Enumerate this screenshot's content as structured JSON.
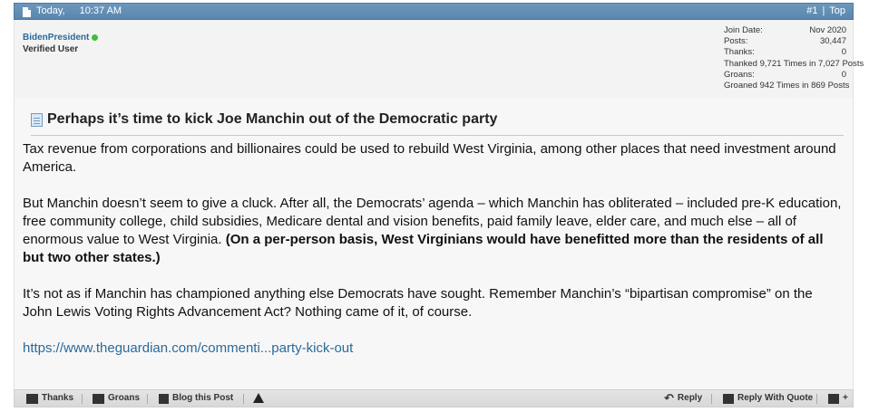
{
  "header": {
    "date": "Today,",
    "time": "10:37 AM",
    "post_number": "#1",
    "separator": "|",
    "top_link": "Top"
  },
  "user": {
    "name": "BidenPresident",
    "title": "Verified User",
    "online": true
  },
  "stats": {
    "join_date_label": "Join Date:",
    "join_date_value": "Nov 2020",
    "posts_label": "Posts:",
    "posts_value": "30,447",
    "thanks_label": "Thanks:",
    "thanks_value": "0",
    "thanked": "Thanked 9,721 Times in 7,027 Posts",
    "groans_label": "Groans:",
    "groans_value": "0",
    "groaned": "Groaned 942 Times in 869 Posts"
  },
  "post": {
    "title": "Perhaps it’s time to kick Joe Manchin out of the Democratic party",
    "p1": "Tax revenue from corporations and billionaires could be used to rebuild West Virginia, among other places that need investment around America.",
    "p2_normal": "But Manchin doesn’t seem to give a cluck. After all, the Democrats’ agenda – which Manchin has obliterated – included pre-K education, free community college, child subsidies, Medicare dental and vision benefits, paid family leave, elder care, and much else – all of enormous value to West Virginia. ",
    "p2_bold": "(On a per-person basis, West Virginians would have benefitted more than the residents of all but two other states.)",
    "p3": "It’s not as if Manchin has championed anything else Democrats have sought. Remember Manchin’s “bipartisan compromise” on the John Lewis Voting Rights Advancement Act? Nothing came of it, of course.",
    "link": "https://www.theguardian.com/commenti...party-kick-out"
  },
  "footer": {
    "thanks": "Thanks",
    "groans": "Groans",
    "blog": "Blog this Post",
    "reply": "Reply",
    "reply_quote": "Reply With Quote"
  },
  "colors": {
    "header_bg": "#6d98bd",
    "username": "#2a6a9a",
    "link": "#2a6a9a",
    "online": "#3cbf3c"
  }
}
